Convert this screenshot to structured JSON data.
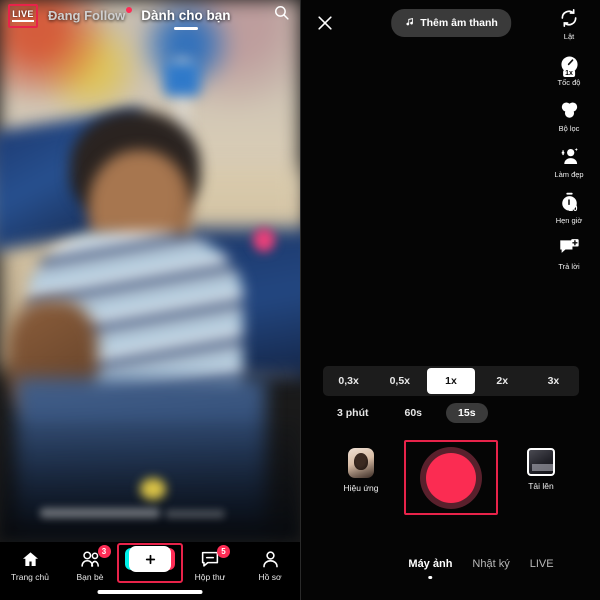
{
  "feed": {
    "live_badge": "LIVE",
    "tabs": [
      {
        "label": "Đang Follow",
        "active": false,
        "has_dot": true
      },
      {
        "label": "Dành cho bạn",
        "active": true,
        "has_dot": false
      }
    ],
    "search_icon": "search-icon",
    "bottom_nav": [
      {
        "label": "Trang chủ",
        "icon": "home-icon",
        "badge": ""
      },
      {
        "label": "Bạn bè",
        "icon": "friends-icon",
        "badge": "3"
      },
      {
        "label": "",
        "icon": "plus-create-icon",
        "badge": ""
      },
      {
        "label": "Hộp thư",
        "icon": "inbox-icon",
        "badge": "5"
      },
      {
        "label": "Hồ sơ",
        "icon": "profile-icon",
        "badge": ""
      }
    ]
  },
  "camera": {
    "close_icon": "close-icon",
    "sound_button": "Thêm âm thanh",
    "sound_icon": "music-note-icon",
    "tools": [
      {
        "label": "Lật",
        "icon": "flip-camera-icon",
        "chip": ""
      },
      {
        "label": "Tốc độ",
        "icon": "speed-icon",
        "chip": "1x"
      },
      {
        "label": "Bộ lọc",
        "icon": "filters-icon",
        "chip": ""
      },
      {
        "label": "Làm đẹp",
        "icon": "beauty-icon",
        "chip": ""
      },
      {
        "label": "Hẹn giờ",
        "icon": "timer-icon",
        "chip": "10"
      },
      {
        "label": "Trả lời",
        "icon": "reply-icon",
        "chip": ""
      }
    ],
    "speed_options": [
      {
        "label": "0,3x",
        "selected": false
      },
      {
        "label": "0,5x",
        "selected": false
      },
      {
        "label": "1x",
        "selected": true
      },
      {
        "label": "2x",
        "selected": false
      },
      {
        "label": "3x",
        "selected": false
      }
    ],
    "duration_options": [
      {
        "label": "3 phút",
        "selected": false
      },
      {
        "label": "60s",
        "selected": false
      },
      {
        "label": "15s",
        "selected": true
      }
    ],
    "effects_label": "Hiệu ứng",
    "upload_label": "Tải lên",
    "record_button": "record-button",
    "modes": [
      {
        "label": "Máy ảnh",
        "selected": true
      },
      {
        "label": "Nhật ký",
        "selected": false
      },
      {
        "label": "LIVE",
        "selected": false
      }
    ]
  },
  "colors": {
    "accent_red": "#fe2c55",
    "accent_cyan": "#00f2ea",
    "highlight_box": "#e8234a",
    "record_fill": "#fb2c52"
  }
}
